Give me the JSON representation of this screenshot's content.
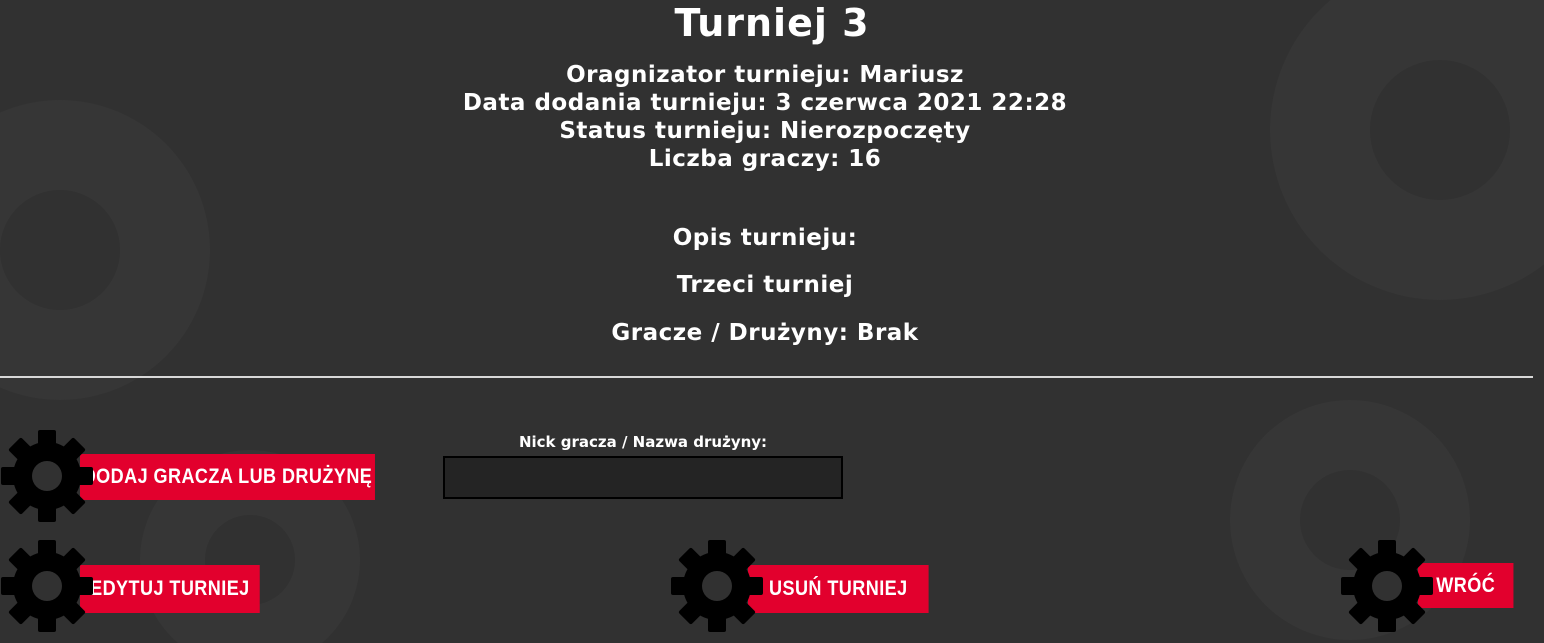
{
  "tournament": {
    "title": "Turniej 3",
    "organizer": "Oragnizator turnieju: Mariusz",
    "date_added": "Data dodania turnieju: 3 czerwca 2021 22:28",
    "status": "Status turnieju: Nierozpoczęty",
    "player_count": "Liczba graczy: 16",
    "description_label": "Opis turnieju:",
    "description": "Trzeci turniej",
    "players_teams": "Gracze / Drużyny: Brak"
  },
  "form": {
    "nick_label": "Nick gracza / Nazwa drużyny:",
    "nick_value": ""
  },
  "buttons": {
    "add": "DODAJ GRACZA LUB DRUŻYNĘ",
    "edit": "EDYTUJ TURNIEJ",
    "delete": "USUŃ TURNIEJ",
    "back": "WRÓĆ"
  },
  "colors": {
    "background": "#313131",
    "button_red": "#e2002d",
    "gear": "#000000",
    "text": "#ffffff"
  },
  "icons": {
    "button_icon": "gear-icon"
  }
}
